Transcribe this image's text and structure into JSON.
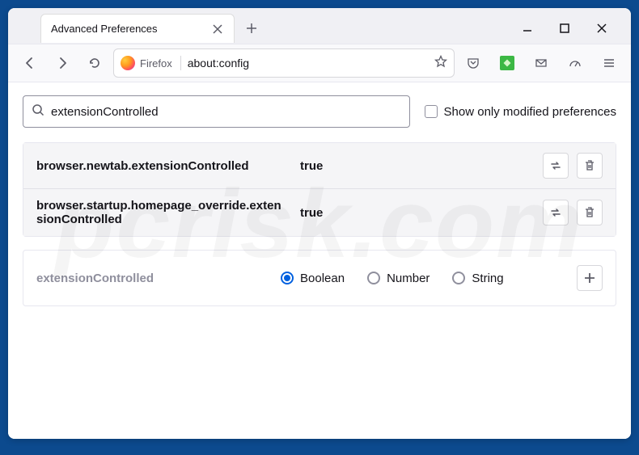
{
  "window": {
    "tabTitle": "Advanced Preferences"
  },
  "urlbar": {
    "identityLabel": "Firefox",
    "url": "about:config"
  },
  "search": {
    "value": "extensionControlled",
    "placeholder": "Search preference name"
  },
  "showOnlyModified": {
    "label": "Show only modified preferences",
    "checked": false
  },
  "prefs": [
    {
      "name": "browser.newtab.extensionControlled",
      "value": "true"
    },
    {
      "name": "browser.startup.homepage_override.extensionControlled",
      "value": "true"
    }
  ],
  "newPref": {
    "proto": "extensionControlled",
    "types": [
      "Boolean",
      "Number",
      "String"
    ],
    "selected": "Boolean"
  },
  "watermark": "pcrisk.com",
  "colors": {
    "accent": "#0060df",
    "extGreen": "#3cb844"
  }
}
